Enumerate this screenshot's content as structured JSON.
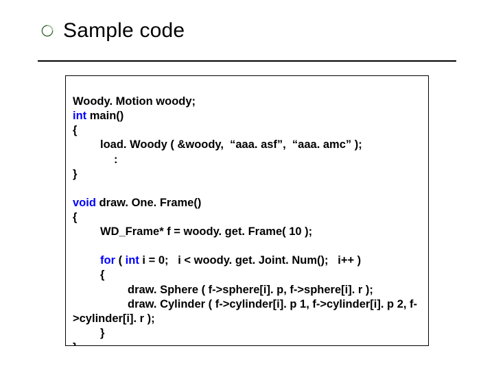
{
  "slide": {
    "title": "Sample code"
  },
  "code": {
    "l01a": "Woody. Motion woody;",
    "l02_kw": "int",
    "l02_rest": " main()",
    "l03": "{",
    "l04": "load. Woody ( &woody,  “aaa. asf”,  “aaa. amc” );",
    "l05": ":",
    "l06": "}",
    "blank1": " ",
    "l07_kw": "void",
    "l07_rest": " draw. One. Frame()",
    "l08": "{",
    "l09": "WD_Frame* f = woody. get. Frame( 10 );",
    "blank2": " ",
    "l10_kw1": "for",
    "l10_mid1": " ( ",
    "l10_kw2": "int",
    "l10_mid2": " i = 0",
    "l10_rest": ";   i < woody. get. Joint. Num();   i++ )",
    "l11": "{",
    "l12": "draw. Sphere ( f->sphere[i]. p, f->sphere[i]. r );",
    "l13a": "draw. Cylinder ( f->cylinder[i]. p 1, f->cylinder[i]. p 2, f-",
    "l13b": ">cylinder[i]. r );",
    "l14": "}",
    "l15": "}"
  }
}
